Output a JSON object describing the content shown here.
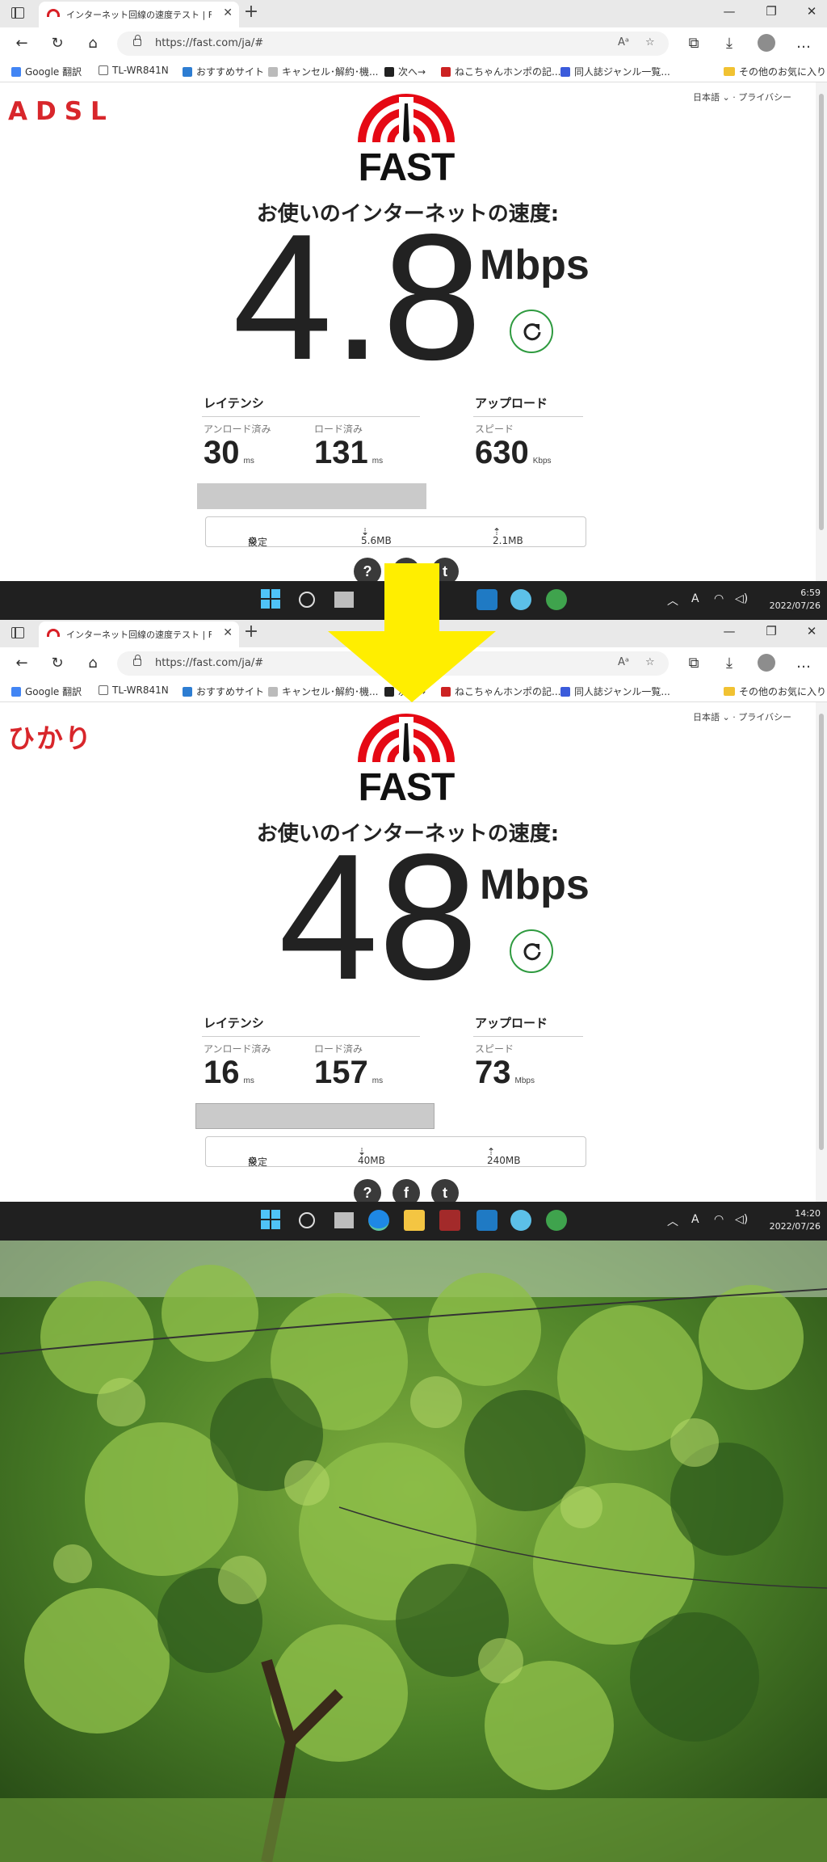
{
  "browser": {
    "tab_title": "インターネット回線の速度テスト | Fast.com",
    "url": "https://fast.com/ja/#",
    "favorites": [
      {
        "label": "Google 翻訳",
        "color": "#4285f4"
      },
      {
        "label": "TL-WR841N",
        "color": "#666666"
      },
      {
        "label": "おすすめサイト",
        "color": "#2d7dd2"
      },
      {
        "label": "キャンセル･解約･機...",
        "color": "#888888"
      },
      {
        "label": "次へ→",
        "color": "#222222"
      },
      {
        "label": "ねこちゃんホンポの記...",
        "color": "#cc2222"
      },
      {
        "label": "同人誌ジャンル一覧...",
        "color": "#3b5bdb"
      }
    ],
    "other_favorites": "その他のお気に入り"
  },
  "page": {
    "language_link": "日本語",
    "privacy_link": "プライバシー",
    "logo_text": "FAST",
    "headline": "お使いのインターネットの速度:",
    "unit": "Mbps",
    "latency_title": "レイテンシ",
    "unloaded_label": "アンロード済み",
    "loaded_label": "ロード済み",
    "upload_title": "アップロード",
    "speed_label": "スピード",
    "settings_label": "設定",
    "ms_unit": "ms"
  },
  "panels": [
    {
      "caption": "ADSL",
      "speed": "4.8",
      "unloaded_latency": "30",
      "loaded_latency": "131",
      "upload_speed": "630",
      "upload_unit": "Kbps",
      "download_data": "5.6MB",
      "upload_data": "2.1MB",
      "clock_time": "6:59",
      "clock_date": "2022/07/26"
    },
    {
      "caption": "ひかり",
      "speed": "48",
      "unloaded_latency": "16",
      "loaded_latency": "157",
      "upload_speed": "73",
      "upload_unit": "Mbps",
      "download_data": "40MB",
      "upload_data": "240MB",
      "clock_time": "14:20",
      "clock_date": "2022/07/26"
    }
  ],
  "colors": {
    "brand_red": "#e50914",
    "refresh_green": "#2e9a3f",
    "caption_red": "#d8262b",
    "arrow_yellow": "#ffee00",
    "taskbar": "#202020"
  },
  "icons": {
    "back": "arrow-left-icon",
    "reload": "reload-icon",
    "home": "home-icon",
    "refresh": "refresh-icon",
    "gear": "gear-icon",
    "start": "windows-start-icon",
    "search": "search-icon"
  }
}
